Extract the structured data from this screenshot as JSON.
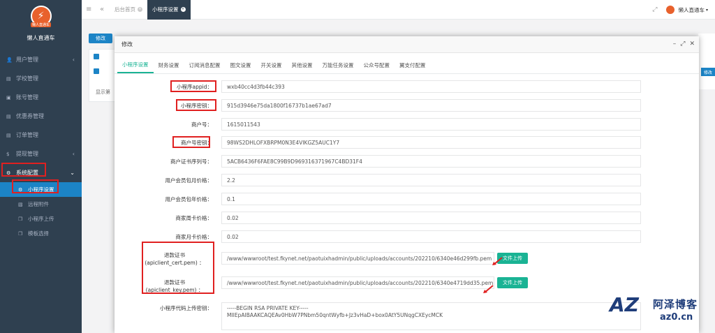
{
  "brand": {
    "logo_sub": "懒人直通车",
    "name": "懒人直通车"
  },
  "sidebar": {
    "items": [
      {
        "label": "用户管理",
        "icon": "user-icon"
      },
      {
        "label": "学校管理",
        "icon": "document-icon"
      },
      {
        "label": "账号管理",
        "icon": "id-card-icon"
      },
      {
        "label": "优惠券管理",
        "icon": "document-icon"
      },
      {
        "label": "订单管理",
        "icon": "document-icon"
      },
      {
        "label": "提现管理",
        "icon": "dollar-icon"
      },
      {
        "label": "系统配置",
        "icon": "gear-icon"
      }
    ],
    "sub_items": [
      {
        "label": "小程序设置",
        "icon": "gear-icon"
      },
      {
        "label": "远程附件",
        "icon": "image-icon"
      },
      {
        "label": "小程序上传",
        "icon": "copy-icon"
      },
      {
        "label": "模板选择",
        "icon": "copy-icon"
      }
    ]
  },
  "topbar": {
    "tabs": [
      "后台首页",
      "小程序设置"
    ],
    "user": "懒人直通车"
  },
  "background": {
    "edit_btn": "修改",
    "footer_text": "显示第",
    "right_btn": "修改"
  },
  "modal": {
    "title": "修改",
    "tabs": [
      "小程序设置",
      "财务设置",
      "订阅消息配置",
      "图文设置",
      "开关设置",
      "其他设置",
      "万能任务设置",
      "公众号配置",
      "翼支付配置"
    ],
    "fields": [
      {
        "label": "小程序appid：",
        "value": "wxb40cc4d3fb44c393"
      },
      {
        "label": "小程序密钥：",
        "value": "915d3946e75da1800f16737b1ae67ad7"
      },
      {
        "label": "商户号：",
        "value": "1615011543"
      },
      {
        "label": "商户号密钥：",
        "value": "98WS2DHLOFXBRPM0N3E4VIKGZ5AUC1Y7"
      },
      {
        "label": "商户证书序列号：",
        "value": "5ACB6436F6FAE8C99B9D969316371967C4BD31F4"
      },
      {
        "label": "用户会员包月价格：",
        "value": "2.2"
      },
      {
        "label": "用户会员包年价格：",
        "value": "0.1"
      },
      {
        "label": "商家周卡价格：",
        "value": "0.02"
      },
      {
        "label": "商家月卡价格：",
        "value": "0.02"
      }
    ],
    "cert": {
      "label1": "退款证书",
      "label1b": "(apiclient_cert.pem) ：",
      "value1": "/www/wwwroot/test.fkynet.net/paotuixhadmin/public/uploads/accounts/202210/6340e46d299fb.pem",
      "label2": "退款证书",
      "label2b": "(apiclient_key.pem) ：",
      "value2": "/www/wwwroot/test.fkynet.net/paotuixhadmin/public/uploads/accounts/202210/6340e4719dd35.pem",
      "upload": "文件上传"
    },
    "key": {
      "label": "小程序代码上传密钥：",
      "line1": "-----BEGIN RSA PRIVATE KEY-----",
      "line2": "MIIEpAIBAAKCAQEAv0HbW7PNbm50qntWyfb+Jz3vHaD+box0AtY5UNqgCXEycMCK"
    }
  },
  "watermark": {
    "cn": "阿泽博客",
    "url": "az0.cn"
  }
}
